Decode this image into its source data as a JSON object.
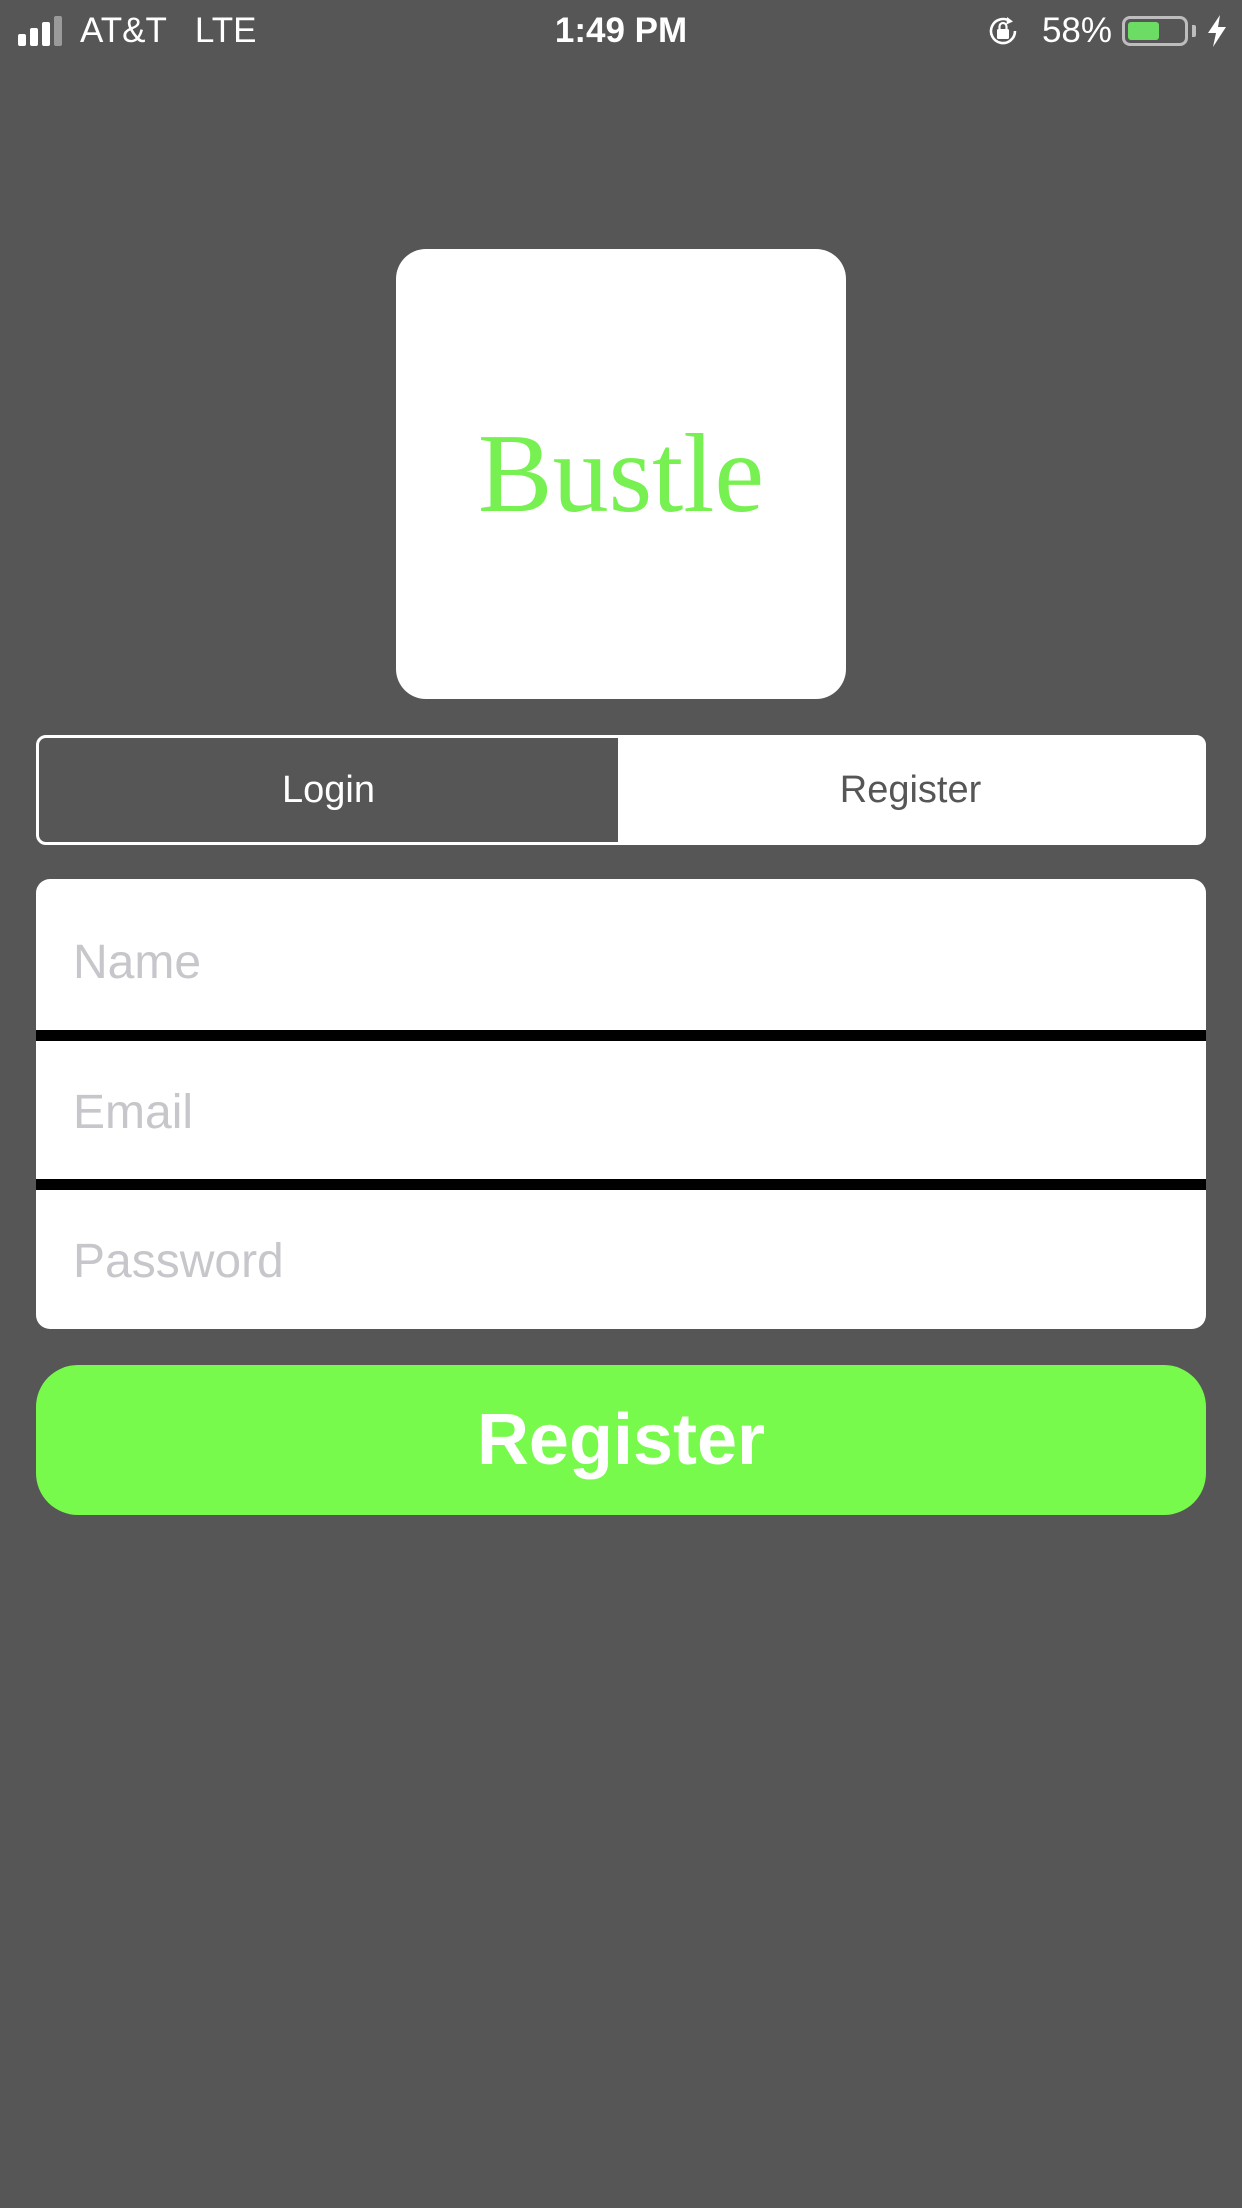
{
  "status_bar": {
    "carrier": "AT&T",
    "network": "LTE",
    "time": "1:49 PM",
    "battery_percent": "58%",
    "battery_level": 0.58,
    "signal_bars_active": 3,
    "signal_bars_total": 4,
    "icons": [
      "cellular-signal-icon",
      "orientation-lock-icon",
      "battery-icon",
      "charging-bolt-icon"
    ]
  },
  "logo": {
    "text": "Bustle",
    "color": "#77f051"
  },
  "segmented_control": {
    "login_label": "Login",
    "register_label": "Register",
    "selected": "Login"
  },
  "form": {
    "name": {
      "value": "",
      "placeholder": "Name"
    },
    "email": {
      "value": "",
      "placeholder": "Email"
    },
    "password": {
      "value": "",
      "placeholder": "Password"
    }
  },
  "register_button": {
    "label": "Register",
    "color": "#77fa4b"
  },
  "colors": {
    "background": "#565656",
    "surface": "#ffffff",
    "divider": "#000000",
    "placeholder": "#c6c6cb"
  }
}
